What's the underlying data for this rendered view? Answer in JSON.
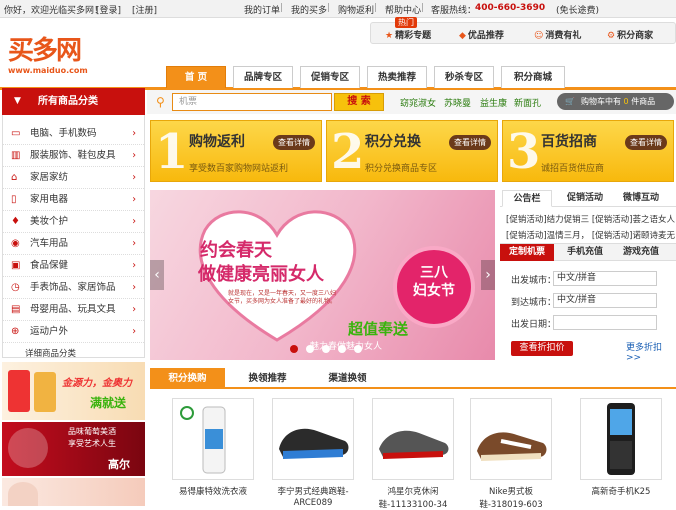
{
  "topbar": {
    "welcome": "你好，欢迎光临买多网！",
    "login": "[登录]",
    "register": "[注册]",
    "links": [
      "我的订单",
      "我的买多",
      "购物返利",
      "帮助中心"
    ],
    "hotline_label": "客服热线：",
    "hotline": "400-660-3690",
    "hotline_note": "(免长途费)"
  },
  "logo": {
    "text": "买多网",
    "url": "www.maiduo.com"
  },
  "toplinks": {
    "badge": "热门",
    "items": [
      "精彩专题",
      "优品推荐",
      "消费有礼",
      "积分商家"
    ]
  },
  "nav": {
    "tabs": [
      "首 页",
      "品牌专区",
      "促销专区",
      "热卖推荐",
      "秒杀专区",
      "积分商城"
    ]
  },
  "category": {
    "title": "所有商品分类",
    "items": [
      "电脑、手机数码",
      "服装服饰、鞋包皮具",
      "家居家纺",
      "家用电器",
      "美妆个护",
      "汽车用品",
      "食品保健",
      "手表饰品、家居饰品",
      "母婴用品、玩具文具",
      "运动户外",
      "详细商品分类"
    ]
  },
  "search": {
    "placeholder": "机票",
    "button": "搜 索",
    "hot_keywords": [
      "窈窕淑女",
      "苏晓曼",
      "益生康",
      "新面孔"
    ],
    "cart": {
      "prefix": "购物车中有",
      "count": "0",
      "suffix": "件商品"
    }
  },
  "promos": [
    {
      "num": "1",
      "title": "购物返利",
      "button": "查看详情",
      "sub": "享受数百家购物网站返利"
    },
    {
      "num": "2",
      "title": "积分兑换",
      "button": "查看详情",
      "sub": "积分兑换商品专区"
    },
    {
      "num": "3",
      "title": "百货招商",
      "button": "查看详情",
      "sub": "诚招百货供应商"
    }
  ],
  "banner": {
    "title1": "约会春天",
    "title2": "做健康亮丽女人",
    "text": "就是现在，又是一年春天，又一度三八妇女节，买多网为女人准备了最好的礼物。",
    "circle_line1": "三八",
    "circle_line2": "妇女节",
    "slogan": "超值奉送",
    "slogan2": "魅力春做魅力女人"
  },
  "notice": {
    "tabs": [
      "公告栏",
      "促销活动",
      "微博互动"
    ],
    "items": [
      "[促销活动]结力促销三 [促销活动]荟之语女人",
      "[促销活动]温情三月， [促销活动]诺颐诗麦无"
    ]
  },
  "ticket": {
    "tabs": [
      "定制机票",
      "手机充值",
      "游戏充值"
    ],
    "from_label": "出发城市：",
    "from_value": "中文/拼音",
    "to_label": "到达城市：",
    "to_value": "中文/拼音",
    "date_label": "出发日期：",
    "button": "查看折扣价",
    "more": "更多折扣>>"
  },
  "ads": {
    "ad1_text": "金源力，金奥力",
    "ad1_sub": "满就送",
    "ad2_line1": "品味葡萄美酒",
    "ad2_line2": "享受艺术人生",
    "ad2_brand": "高尔"
  },
  "products": {
    "tabs": [
      "积分换购",
      "换领推荐",
      "渠道换领"
    ],
    "items": [
      {
        "name": "易得康特效洗衣液",
        "name2": ""
      },
      {
        "name": "李宁男式经典跑鞋-",
        "name2": "ARCE089"
      },
      {
        "name": "鸿星尔克休闲",
        "name2": "鞋-11133100-34"
      },
      {
        "name": "Nike男式板",
        "name2": "鞋-318019-603"
      },
      {
        "name": "高新奇手机K25",
        "name2": ""
      }
    ]
  },
  "colors": {
    "brand": "#e8561a",
    "nav": "#f39019",
    "category": "#c8100d"
  }
}
